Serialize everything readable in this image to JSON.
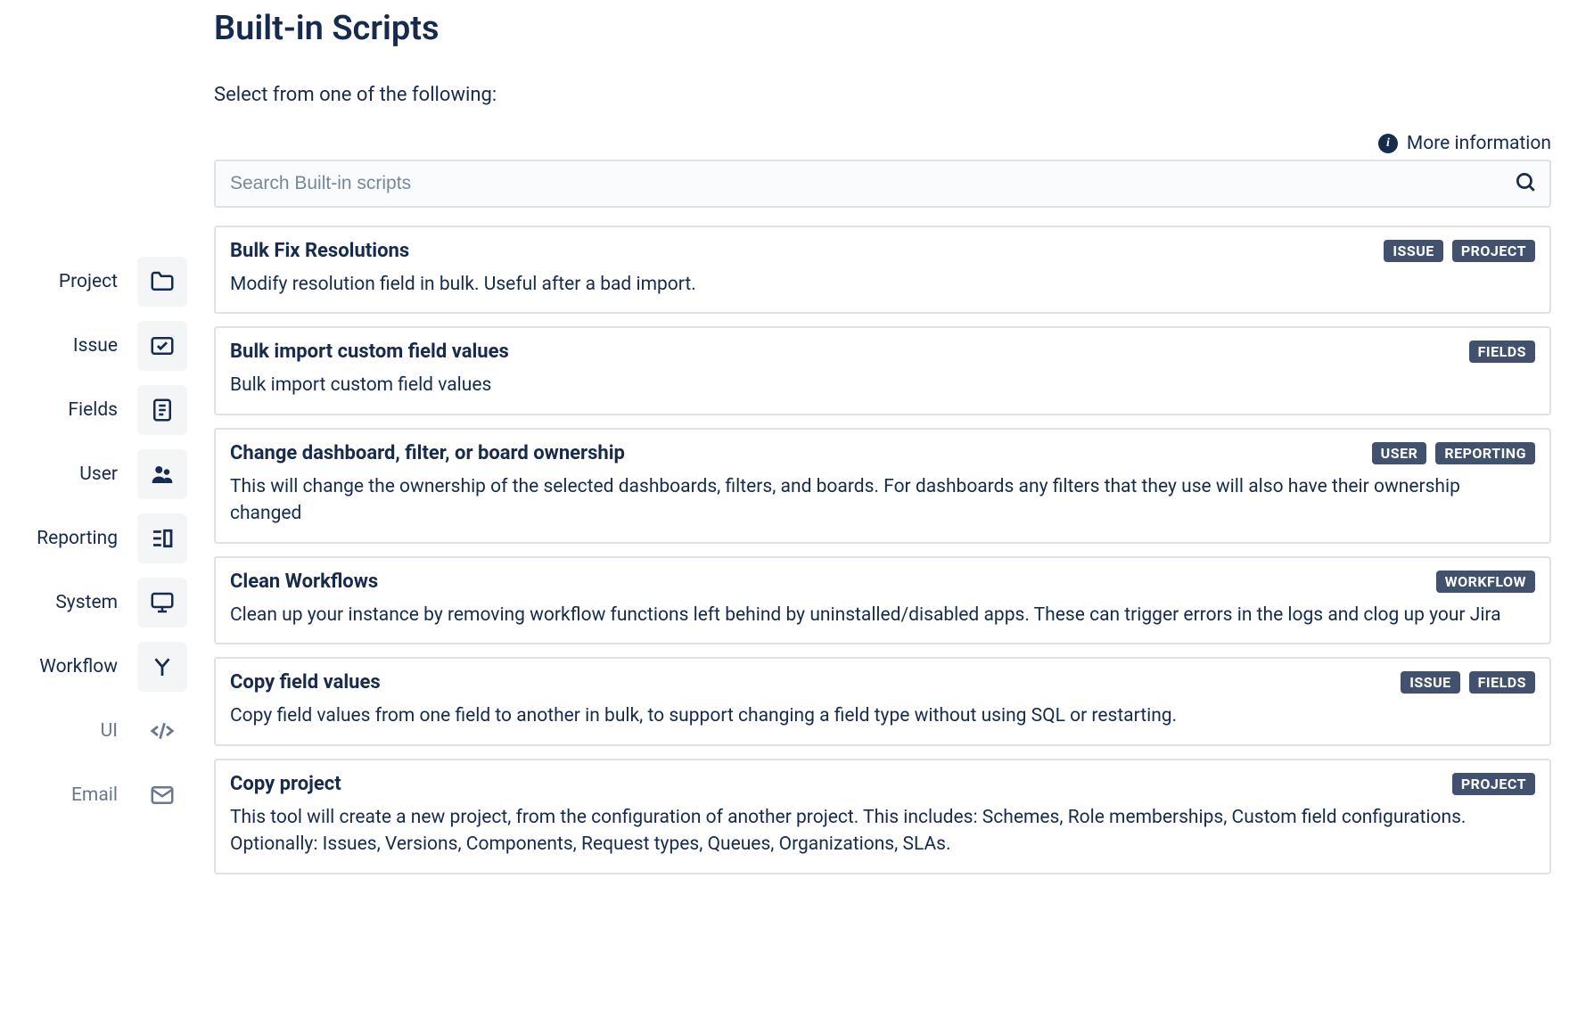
{
  "header": {
    "title": "Built-in Scripts",
    "subtitle": "Select from one of the following:",
    "more_info": "More information",
    "search_placeholder": "Search Built-in scripts"
  },
  "sidebar": {
    "items": [
      {
        "label": "Project"
      },
      {
        "label": "Issue"
      },
      {
        "label": "Fields"
      },
      {
        "label": "User"
      },
      {
        "label": "Reporting"
      },
      {
        "label": "System"
      },
      {
        "label": "Workflow"
      },
      {
        "label": "UI"
      },
      {
        "label": "Email"
      }
    ]
  },
  "scripts": [
    {
      "title": "Bulk Fix Resolutions",
      "desc": "Modify resolution field in bulk. Useful after a bad import.",
      "badges": [
        "ISSUE",
        "PROJECT"
      ]
    },
    {
      "title": "Bulk import custom field values",
      "desc": "Bulk import custom field values",
      "badges": [
        "FIELDS"
      ]
    },
    {
      "title": "Change dashboard, filter, or board ownership",
      "desc": "This will change the ownership of the selected dashboards, filters, and boards. For dashboards any filters that they use will also have their ownership changed",
      "badges": [
        "USER",
        "REPORTING"
      ]
    },
    {
      "title": "Clean Workflows",
      "desc": "Clean up your instance by removing workflow functions left behind by uninstalled/disabled apps. These can trigger errors in the logs and clog up your Jira",
      "badges": [
        "WORKFLOW"
      ]
    },
    {
      "title": "Copy field values",
      "desc": "Copy field values from one field to another in bulk, to support changing a field type without using SQL or restarting.",
      "badges": [
        "ISSUE",
        "FIELDS"
      ]
    },
    {
      "title": "Copy project",
      "desc": "This tool will create a new project, from the configuration of another project. This includes: Schemes, Role memberships, Custom field configurations. Optionally: Issues, Versions, Components, Request types, Queues, Organizations, SLAs.",
      "badges": [
        "PROJECT"
      ]
    }
  ]
}
